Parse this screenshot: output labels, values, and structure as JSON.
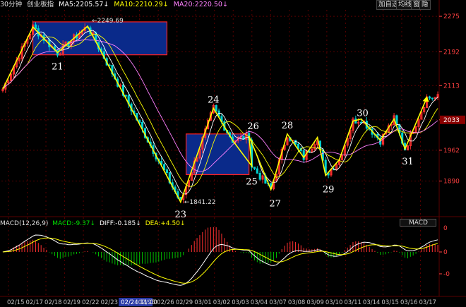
{
  "header": {
    "period": "30分钟",
    "index_name": "创业板指",
    "ma5_label": "MA5:",
    "ma5_value": "2205.57",
    "ma10_label": "MA10:",
    "ma10_value": "2210.29",
    "ma20_label": "MA20:",
    "ma20_value": "2220.50",
    "down_arrow": "↓"
  },
  "toolbar": {
    "add_watch": "加自选",
    "ma_line": "均线",
    "window": "窗",
    "zoom_out": "隐"
  },
  "macd_header": {
    "params": "MACD(12,26,9)",
    "macd_label": "MACD:",
    "macd_value": "-9.37",
    "diff_label": "DIFF:",
    "diff_value": "-0.185",
    "dea_label": "DEA:",
    "dea_value": "+4.50",
    "indicator_name": "MACD"
  },
  "colors": {
    "background": "#000000",
    "grid": "#5a0000",
    "up": "#ff3030",
    "down": "#00d0d0",
    "ma5": "#ffffff",
    "ma10": "#ffff00",
    "ma20": "#ff80ff",
    "wave": "#ffff00",
    "box_fill": "#0a2a8a",
    "box_border": "#ff2020",
    "axis_text": "#ff4040",
    "date_text": "#c0c0c0",
    "highlight_date_bg": "#2a3aa8",
    "macd_pos": "#ff3030",
    "macd_neg": "#00c000"
  },
  "chart_data": {
    "type": "candlestick",
    "title": "创业板指 30分钟",
    "ylim": [
      1810,
      2290
    ],
    "y_ticks": [
      2275,
      2192,
      2113,
      2033,
      1962,
      1890
    ],
    "current_price": 2033,
    "x_dates": [
      "02/15",
      "02/17",
      "02/18",
      "02/19",
      "02/22",
      "02/23",
      "02/24 11:00",
      "02/25",
      "02/26",
      "02/29",
      "03/01",
      "03/02",
      "03/03",
      "03/04",
      "03/07",
      "03/08",
      "03/09",
      "03/10",
      "03/11",
      "03/14",
      "03/15",
      "03/16",
      "03/17"
    ],
    "highlighted_date": "02/24 11:00",
    "annotations": {
      "high_label": "2249.69",
      "low_label": "1841.22"
    },
    "wave_points": [
      {
        "label": "",
        "x": 0,
        "y": 2105
      },
      {
        "label": "",
        "x": 11,
        "y": 2250
      },
      {
        "label": "21",
        "x": 20,
        "y": 2190
      },
      {
        "label": "",
        "x": 31,
        "y": 2252
      },
      {
        "label": "23",
        "x": 65,
        "y": 1841
      },
      {
        "label": "24",
        "x": 77,
        "y": 2060
      },
      {
        "label": "",
        "x": 84,
        "y": 1985
      },
      {
        "label": "25",
        "x": 91,
        "y": 1925
      },
      {
        "label": "26",
        "x": 90,
        "y": 1995
      },
      {
        "label": "27",
        "x": 98,
        "y": 1870
      },
      {
        "label": "28",
        "x": 104,
        "y": 2000
      },
      {
        "label": "",
        "x": 110,
        "y": 1945
      },
      {
        "label": "",
        "x": 115,
        "y": 1992
      },
      {
        "label": "29",
        "x": 118,
        "y": 1903
      },
      {
        "label": "",
        "x": 123,
        "y": 1940
      },
      {
        "label": "",
        "x": 128,
        "y": 2030
      },
      {
        "label": "30",
        "x": 131,
        "y": 2035
      },
      {
        "label": "",
        "x": 138,
        "y": 1985
      },
      {
        "label": "",
        "x": 143,
        "y": 2035
      },
      {
        "label": "31",
        "x": 147,
        "y": 1965
      },
      {
        "label": "",
        "x": 155,
        "y": 2085
      }
    ],
    "rectangles": [
      {
        "x0": 11,
        "x1": 60,
        "y0": 2185,
        "y1": 2262
      },
      {
        "x0": 67,
        "x1": 90,
        "y0": 1905,
        "y1": 2000
      }
    ],
    "macd": {
      "ylim": [
        -35,
        10
      ],
      "y_ticks": [
        0,
        0
      ]
    }
  }
}
